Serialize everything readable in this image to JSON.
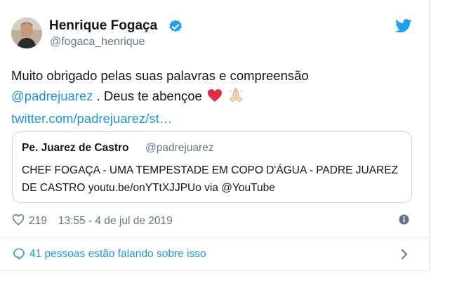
{
  "author": {
    "name": "Henrique Fogaça",
    "handle": "@fogaca_henrique"
  },
  "tweet": {
    "text_before_mention": "Muito obrigado pelas suas palavras e compreensão",
    "mention": "@padrejuarez",
    "text_after_mention": " . Deus te abençoe",
    "link": "twitter.com/padrejuarez/st…",
    "emojis": [
      "red-heart",
      "folded-hands"
    ]
  },
  "quoted_tweet": {
    "name": "Pe. Juarez de Castro",
    "handle": "@padrejuarez",
    "text": "CHEF FOGAÇA - UMA TEMPESTADE EM COPO D'ÁGUA - PADRE JUAREZ DE CASTRO youtu.be/onYTtXJJPUo via @YouTube"
  },
  "footer": {
    "likes": "219",
    "timestamp": "13:55 - 4 de jul de 2019"
  },
  "conversation": {
    "label": "41 pessoas estão falando sobre isso"
  },
  "colors": {
    "link": "#1b95e0",
    "secondary_text": "#657786",
    "border": "#e1e8ed",
    "verified": "#1da1f2"
  }
}
